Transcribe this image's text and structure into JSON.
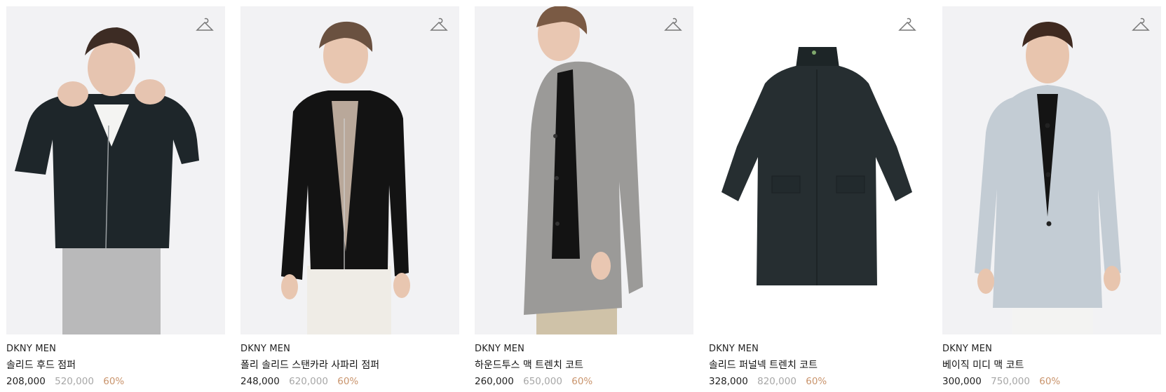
{
  "products": [
    {
      "brand": "DKNY MEN",
      "name": "솔리드 후드 점퍼",
      "price": "208,000",
      "original_price": "520,000",
      "discount": "60%"
    },
    {
      "brand": "DKNY MEN",
      "name": "폴리 솔리드 스탠카라 사파리 점퍼",
      "price": "248,000",
      "original_price": "620,000",
      "discount": "60%"
    },
    {
      "brand": "DKNY MEN",
      "name": "하운드투스 맥 트렌치 코트",
      "price": "260,000",
      "original_price": "650,000",
      "discount": "60%"
    },
    {
      "brand": "DKNY MEN",
      "name": "솔리드 퍼널넥 트렌치 코트",
      "price": "328,000",
      "original_price": "820,000",
      "discount": "60%"
    },
    {
      "brand": "DKNY MEN",
      "name": "베이직 미디 맥 코트",
      "price": "300,000",
      "original_price": "750,000",
      "discount": "60%"
    }
  ],
  "icons": {
    "wishlist": "hanger-icon"
  },
  "colors": {
    "discount": "#c9946c",
    "original_price": "#a7a7a7",
    "image_bg": "#f2f2f4"
  }
}
